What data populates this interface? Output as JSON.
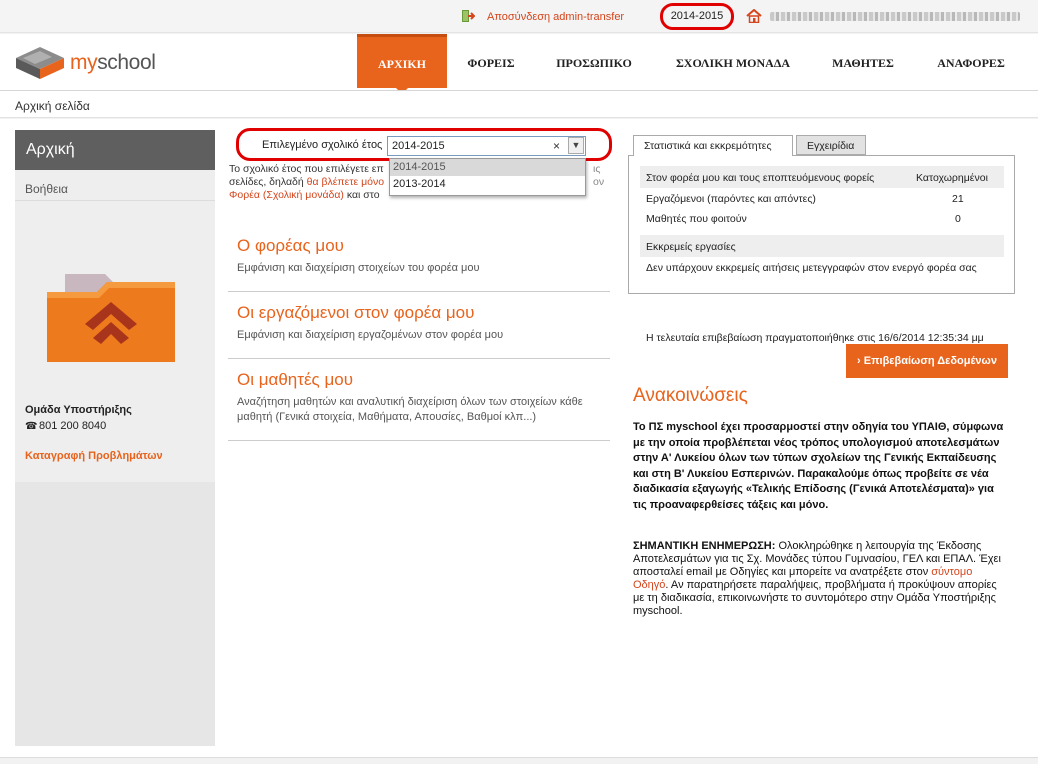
{
  "topbar": {
    "logout_label": "Αποσύνδεση admin-transfer",
    "school_year": "2014-2015"
  },
  "logo": {
    "my": "my",
    "school": "school"
  },
  "nav": {
    "home": "ΑΡΧΙΚΗ",
    "foreis": "ΦΟΡΕΙΣ",
    "prosopiko": "ΠΡΟΣΩΠΙΚΟ",
    "monada": "ΣΧΟΛΙΚΗ ΜΟΝΑΔΑ",
    "mathites": "ΜΑΘΗΤΕΣ",
    "anafores": "ΑΝΑΦΟΡΕΣ"
  },
  "breadcrumb": "Αρχική σελίδα",
  "sidebar": {
    "title": "Αρχική",
    "help": "Βοήθεια",
    "support_title": "Ομάδα Υποστήριξης",
    "phone_icon": "☎",
    "support_phone": "801 200 8040",
    "report_link": "Καταγραφή Προβλημάτων"
  },
  "year_selector": {
    "label": "Επιλεγμένο σχολικό έτος",
    "value": "2014-2015",
    "clear": "×",
    "options": [
      "2014-2015",
      "2013-2014"
    ]
  },
  "intro": {
    "line1": "Το σχολικό έτος που επιλέγετε επ",
    "line2a": "σελίδες, δηλαδή ",
    "line2b": "θα βλέπετε μόνο",
    "line3a": "Φορέα (Σχολική μονάδα)",
    "line3b": " και στο",
    "tail1": "ις",
    "tail2": "ον"
  },
  "cards": [
    {
      "title": "Ο φορέας μου",
      "desc": "Εμφάνιση και διαχείριση στοιχείων του φορέα μου"
    },
    {
      "title": "Οι εργαζόμενοι στον φορέα μου",
      "desc": "Εμφάνιση και διαχείριση εργαζομένων στον φορέα μου"
    },
    {
      "title": "Οι μαθητές μου",
      "desc": "Αναζήτηση μαθητών και αναλυτική διαχείριση όλων των στοιχείων κάθε μαθητή (Γενικά στοιχεία, Μαθήματα, Απουσίες, Βαθμοί κλπ...)"
    }
  ],
  "tabs": {
    "stats": "Στατιστικά και εκκρεμότητες",
    "manuals": "Εγχειρίδια"
  },
  "stats": {
    "head_label": "Στον φορέα μου και τους εποπτευόμενους φορείς",
    "head_col": "Κατοχωρημένοι",
    "rows": [
      {
        "label": "Εργαζόμενοι (παρόντες και απόντες)",
        "value": "21"
      },
      {
        "label": "Μαθητές που φοιτούν",
        "value": "0"
      }
    ],
    "pending_label": "Εκκρεμείς εργασίες",
    "pending_text": "Δεν υπάρχουν εκκρεμείς αιτήσεις μετεγγραφών στον ενεργό φορέα σας"
  },
  "confirm": {
    "last_text": "Η τελευταία επιβεβαίωση πραγματοποιήθηκε στις 16/6/2014 12:35:34 μμ",
    "button": "› Επιβεβαίωση Δεδομένων"
  },
  "announcements": {
    "title": "Ανακοινώσεις",
    "bold_text": "Το ΠΣ myschool έχει προσαρμοστεί στην οδηγία του ΥΠΑΙΘ, σύμφωνα με την οποία προβλέπεται νέος τρόπος υπολογισμού αποτελεσμάτων στην Α' Λυκείου όλων των τύπων σχολείων της Γενικής Εκπαίδευσης και στη Β' Λυκείου Εσπερινών. Παρακαλούμε όπως προβείτε σε νέα διαδικασία εξαγωγής «Τελικής Επίδοσης (Γενικά Αποτελέσματα)» για τις προαναφερθείσες τάξεις και μόνο.",
    "note_label": "ΣΗΜΑΝΤΙΚΗ ΕΝΗΜΕΡΩΣΗ:",
    "note_text_1": " Ολοκληρώθηκε η λειτουργία της Έκδοσης Αποτελεσμάτων για τις Σχ. Μονάδες τύπου Γυμνασίου, ΓΕΛ και ΕΠΑΛ. Έχει αποσταλεί email με Οδηγίες και μπορείτε να ανατρέξετε στον ",
    "note_link": "σύντομο Οδηγό",
    "note_text_2": ". Αν παρατηρήσετε παραλήψεις, προβλήματα ή προκύψουν απορίες με τη διαδικασία, επικοινωνήστε το συντομότερο στην Ομάδα Υποστήριξης myschool."
  },
  "colors": {
    "accent": "#e8631c",
    "highlight": "#e00000",
    "sidebar_title": "#5f5f5f"
  }
}
